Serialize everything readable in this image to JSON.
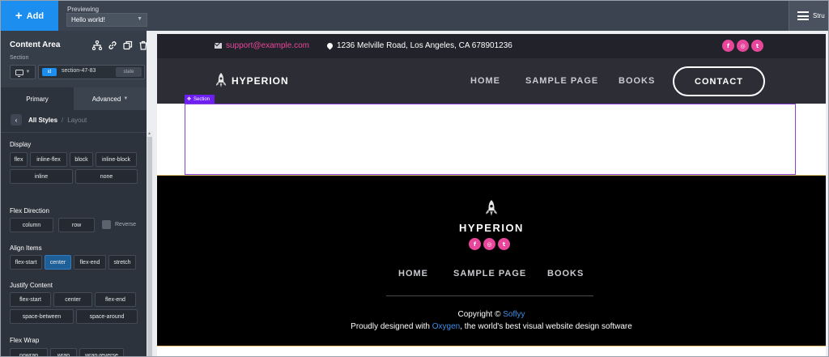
{
  "topbar": {
    "add_label": "Add",
    "previewing_label": "Previewing",
    "preview_value": "Hello world!",
    "structure_label": "Stru"
  },
  "panel": {
    "title": "Content Area",
    "subtitle": "Section",
    "id_badge": "id",
    "id_value": "section-47-83",
    "state_label": "state",
    "tabs": [
      {
        "label": "Primary"
      },
      {
        "label": "Advanced"
      }
    ],
    "breadcrumb": {
      "all_styles": "All Styles",
      "separator": "/",
      "layout": "Layout"
    },
    "display": {
      "heading": "Display",
      "options": [
        "flex",
        "inline-flex",
        "block",
        "inline-block",
        "inline",
        "none"
      ]
    },
    "flex_direction": {
      "heading": "Flex Direction",
      "options": [
        "column",
        "row"
      ],
      "reverse_label": "Reverse"
    },
    "align_items": {
      "heading": "Align Items",
      "options": [
        "flex-start",
        "center",
        "flex-end",
        "stretch"
      ],
      "selected": "center"
    },
    "justify_content": {
      "heading": "Justify Content",
      "options": [
        "flex-start",
        "center",
        "flex-end",
        "space-between",
        "space-around"
      ]
    },
    "flex_wrap": {
      "heading": "Flex Wrap",
      "options": [
        "nowrap",
        "wrap",
        "wrap-reverse"
      ]
    }
  },
  "site": {
    "email": "support@example.com",
    "address": "1236 Melville Road, Los Angeles, CA 678901236",
    "social": [
      "f",
      "ig",
      "t"
    ],
    "brand": "HYPERION",
    "menu": [
      "HOME",
      "SAMPLE PAGE",
      "BOOKS"
    ],
    "contact_label": "CONTACT",
    "section_tag": "Section",
    "footer": {
      "brand": "HYPERION",
      "menu": [
        "HOME",
        "SAMPLE PAGE",
        "BOOKS"
      ],
      "copyright_prefix": "Copyright ©",
      "copyright_link": "Soflyy",
      "credit_prefix": "Proudly designed with",
      "credit_link": "Oxygen",
      "credit_suffix": ", the world's best visual website design software"
    }
  },
  "colors": {
    "accent_blue": "#1c8ef0",
    "pink": "#e8469a",
    "selection_purple": "#6c1ff0",
    "link_blue": "#3b8ee6"
  }
}
